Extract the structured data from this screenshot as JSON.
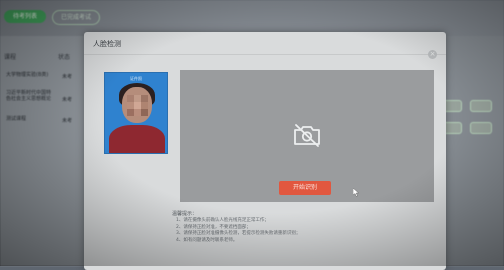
{
  "background": {
    "tabs": [
      {
        "label": "待考列表"
      },
      {
        "label": "已完成考试"
      }
    ],
    "columns": [
      {
        "label": "课程"
      },
      {
        "label": "状态"
      }
    ],
    "rows": [
      {
        "title": "大学物理实验(B类)",
        "status": "未考"
      },
      {
        "title": "习近平新时代中国特色社会主义思想概论",
        "status": "未考"
      },
      {
        "title": "测试课程",
        "status": "未考"
      }
    ]
  },
  "modal": {
    "title": "人脸检测",
    "close_symbol": "×",
    "photo_label": "证件照",
    "start_button": "开始识别",
    "notes_title": "温馨提示：",
    "notes": [
      "1、请在摄像头前确认人脸光线充足正常工作；",
      "2、请保持正脸对准，不要遮挡面部；",
      "3、请保持正脸对准摄像头检测，若提示检测失败请重新识别；",
      "4、如有问题请及时联系老师。"
    ]
  },
  "colors": {
    "accent_green": "#41a35c",
    "start_button": "#e1573f",
    "photo_background": "#2f82cf"
  },
  "icons": [
    "camera-off-icon",
    "close-icon",
    "cursor-icon"
  ]
}
